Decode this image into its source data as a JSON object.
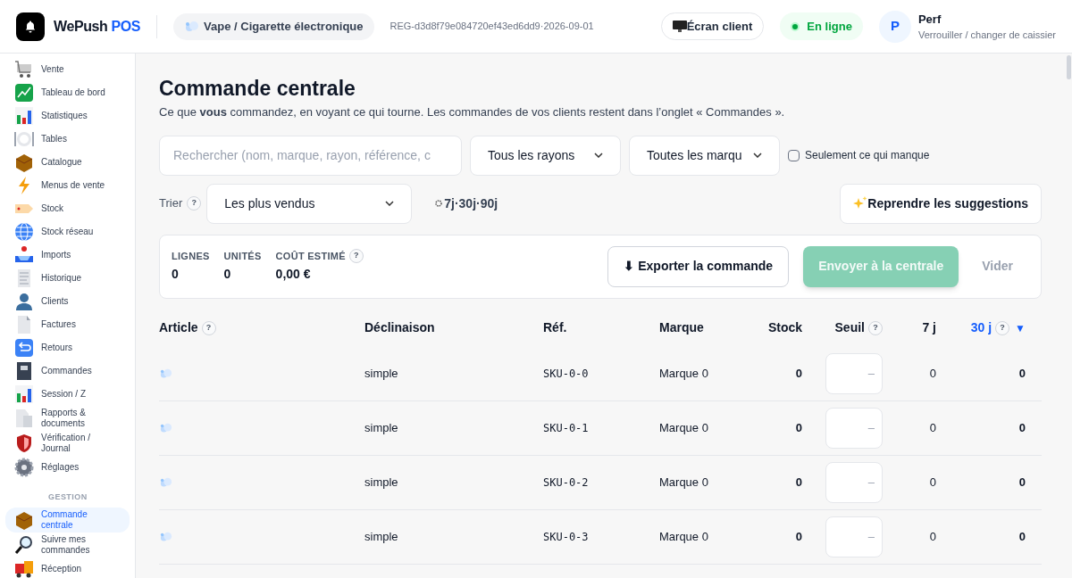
{
  "header": {
    "brand": "WePush",
    "brand_accent": "POS",
    "store": "Vape / Cigarette électronique",
    "register_id": "REG-d3d8f79e084720ef43ed6dd9·2026-09-01",
    "customer_screen_button": "Écran client",
    "status": {
      "label": "En ligne",
      "online": true
    },
    "user": {
      "initial": "P",
      "name": "Perf",
      "subtitle": "Verrouiller / changer de caissier"
    }
  },
  "sidebar": {
    "items": [
      {
        "label": "Vente",
        "selected": false
      },
      {
        "label": "Tableau de bord",
        "selected": false
      },
      {
        "label": "Statistiques",
        "selected": false
      },
      {
        "label": "Tables",
        "selected": false
      },
      {
        "label": "Catalogue",
        "selected": false
      },
      {
        "label": "Menus de vente",
        "selected": false
      },
      {
        "label": "Stock",
        "selected": false
      },
      {
        "label": "Stock réseau",
        "selected": false
      },
      {
        "label": "Imports",
        "selected": false
      },
      {
        "label": "Historique",
        "selected": false
      },
      {
        "label": "Clients",
        "selected": false
      },
      {
        "label": "Factures",
        "selected": false
      },
      {
        "label": "Retours",
        "selected": false
      },
      {
        "label": "Commandes",
        "selected": false
      },
      {
        "label": "Session / Z",
        "selected": false
      },
      {
        "label": "Rapports & documents",
        "selected": false
      },
      {
        "label": "Vérification / Journal",
        "selected": false
      },
      {
        "label": "Réglages",
        "selected": false
      }
    ],
    "section_title": "GESTION",
    "section_items": [
      {
        "label": "Commande centrale",
        "selected": true
      },
      {
        "label": "Suivre mes commandes",
        "selected": false
      },
      {
        "label": "Réception",
        "selected": false
      }
    ]
  },
  "page": {
    "title": "Commande centrale",
    "subtitle": "Ce que **vous** commandez, en voyant ce qui tourne. Les commandes de vos clients restent dans l’onglet « Commandes ».",
    "search": {
      "placeholder": "Rechercher (nom, marque, rayon, référence, c"
    },
    "rayon_select": "Tous les rayons",
    "brand_select": "Toutes les marqu",
    "only_missing": {
      "label": "Seulement ce qui manque",
      "checked": false
    },
    "sort_label": "Trier",
    "sort_help": "?",
    "sort_select": "Les plus vendus",
    "periods": "7j·30j·90j",
    "suggestions_button": "Reprendre les suggestions"
  },
  "summary": {
    "stats": [
      {
        "label": "LIGNES",
        "value": "0"
      },
      {
        "label": "UNITÉS",
        "value": "0"
      },
      {
        "label": "COÛT ESTIMÉ",
        "value": "0,00 €",
        "help": "?"
      }
    ],
    "export_button": "⬇ Exporter la commande",
    "send_button": {
      "label": "Envoyer à la centrale",
      "disabled": true
    },
    "clear_button": {
      "label": "Vider",
      "disabled": true
    }
  },
  "table": {
    "columns": [
      {
        "label": "Article",
        "help": "?",
        "sorted": false
      },
      {
        "label": "Déclinaison",
        "sorted": false
      },
      {
        "label": "Réf.",
        "sorted": false
      },
      {
        "label": "Marque",
        "sorted": false
      },
      {
        "label": "Stock",
        "sorted": false
      },
      {
        "label": "Seuil",
        "help": "?",
        "sorted": false
      },
      {
        "label": "7 j",
        "sorted": false
      },
      {
        "label": "30 j",
        "help": "?",
        "sorted": true,
        "sort_indicator": "▼"
      }
    ],
    "rows": [
      {
        "variant": "simple",
        "ref": "SKU-0-0",
        "brand": "Marque 0",
        "stock": "0",
        "threshold": {
          "placeholder": "–"
        },
        "d7": "0",
        "d30": "0"
      },
      {
        "variant": "simple",
        "ref": "SKU-0-1",
        "brand": "Marque 0",
        "stock": "0",
        "threshold": {
          "placeholder": "–"
        },
        "d7": "0",
        "d30": "0"
      },
      {
        "variant": "simple",
        "ref": "SKU-0-2",
        "brand": "Marque 0",
        "stock": "0",
        "threshold": {
          "placeholder": "–"
        },
        "d7": "0",
        "d30": "0"
      },
      {
        "variant": "simple",
        "ref": "SKU-0-3",
        "brand": "Marque 0",
        "stock": "0",
        "threshold": {
          "placeholder": "–"
        },
        "d7": "0",
        "d30": "0"
      }
    ]
  }
}
